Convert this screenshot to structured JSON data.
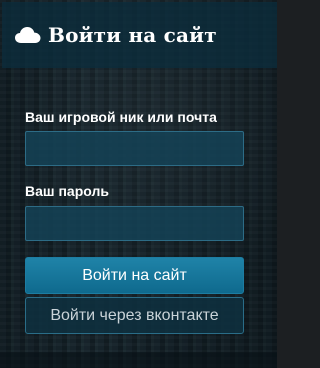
{
  "header": {
    "icon": "cloud-icon",
    "title": "Войти на сайт"
  },
  "form": {
    "nick_label": "Ваш игровой ник или почта",
    "nick_value": "",
    "password_label": "Ваш пароль",
    "password_value": ""
  },
  "buttons": {
    "login": "Войти на сайт",
    "vk_login": "Войти через вконтакте"
  },
  "colors": {
    "header_bg": "#0c2d3c",
    "primary_button": "#1a7ea3",
    "input_border": "#2d6c86"
  }
}
